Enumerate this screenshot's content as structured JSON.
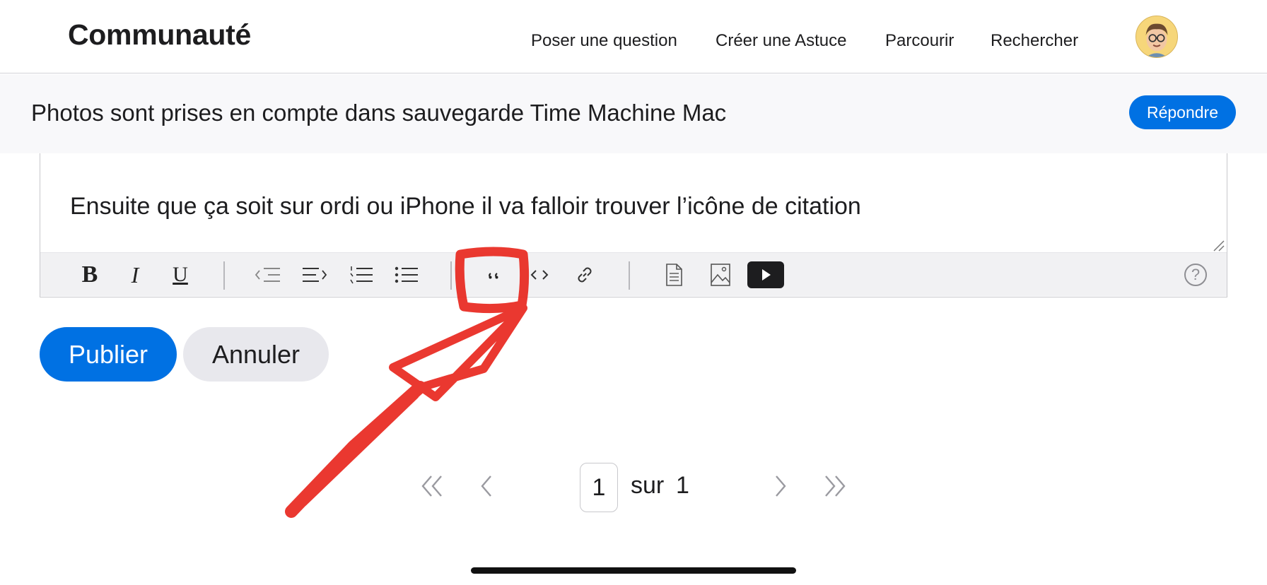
{
  "header": {
    "brand": "Communauté",
    "nav": [
      "Poser une question",
      "Créer une Astuce",
      "Parcourir",
      "Rechercher"
    ],
    "avatar_icon": "memoji-avatar"
  },
  "thread": {
    "title": "Photos sont prises en compte dans sauvegarde Time Machine Mac",
    "reply_label": "Répondre"
  },
  "editor": {
    "text": "Ensuite que ça soit sur ordi ou iPhone il va falloir trouver l’icône de citation",
    "toolbar_icons": [
      "bold-icon",
      "italic-icon",
      "underline-icon",
      "outdent-icon",
      "indent-icon",
      "numbered-list-icon",
      "bulleted-list-icon",
      "quote-icon",
      "code-icon",
      "link-icon",
      "document-icon",
      "image-icon",
      "video-icon",
      "help-icon"
    ],
    "bold_glyph": "B",
    "italic_glyph": "I",
    "underline_glyph": "U",
    "help_glyph": "?",
    "annotation_color": "#e8231a"
  },
  "actions": {
    "publish_label": "Publier",
    "cancel_label": "Annuler"
  },
  "pagination": {
    "current_page": "1",
    "of_label": "sur",
    "total_pages": "1"
  },
  "colors": {
    "accent": "#0071e3",
    "secondary_button": "#e8e8ed",
    "titlebar_bg": "#f8f8fa",
    "toolbar_bg": "#f1f1f3"
  }
}
